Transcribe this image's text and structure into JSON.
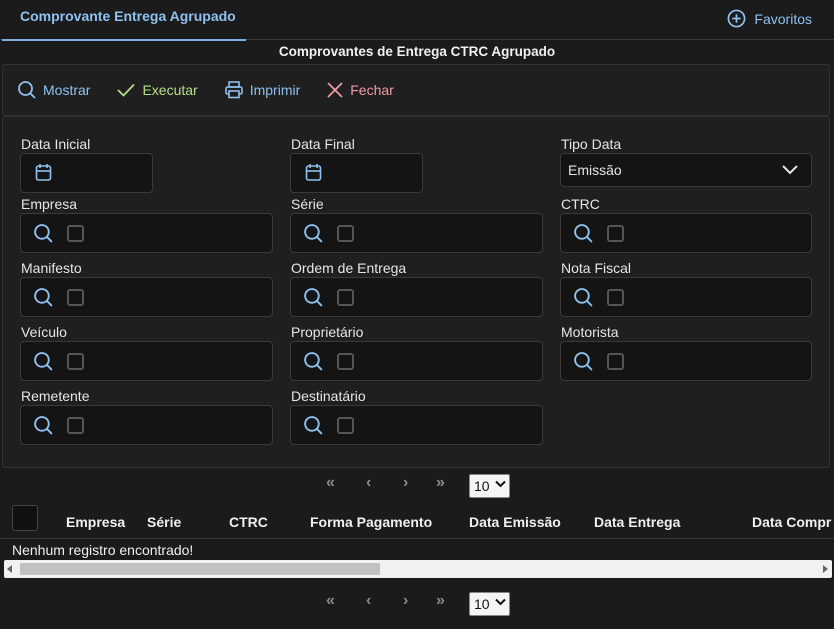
{
  "tabs": {
    "active_label": "Comprovante Entrega Agrupado"
  },
  "favoritos": {
    "label": "Favoritos"
  },
  "page": {
    "title": "Comprovantes de Entrega CTRC Agrupado"
  },
  "toolbar": {
    "mostrar": "Mostrar",
    "executar": "Executar",
    "imprimir": "Imprimir",
    "fechar": "Fechar"
  },
  "form": {
    "data_inicial": "Data Inicial",
    "data_final": "Data Final",
    "tipo_data": "Tipo Data",
    "tipo_data_value": "Emissão",
    "empresa": "Empresa",
    "serie": "Série",
    "ctrc": "CTRC",
    "manifesto": "Manifesto",
    "ordem_entrega": "Ordem de Entrega",
    "nota_fiscal": "Nota Fiscal",
    "veiculo": "Veículo",
    "proprietario": "Proprietário",
    "motorista": "Motorista",
    "remetente": "Remetente",
    "destinatario": "Destinatário"
  },
  "pager": {
    "first": "«",
    "prev": "‹",
    "next": "›",
    "last": "»",
    "rows_per_page": "10"
  },
  "grid": {
    "columns": [
      "Empresa",
      "Série",
      "CTRC",
      "Forma Pagamento",
      "Data Emissão",
      "Data Entrega",
      "Data Compr"
    ],
    "empty_message": "Nenhum registro encontrado!"
  },
  "colors": {
    "accent_blue": "#8ec1ef",
    "accent_green": "#b5e08a",
    "accent_red": "#f09aa8",
    "background": "#1b1b1b"
  },
  "icons": {
    "favoritos": "plus-circle-icon",
    "mostrar": "search-icon",
    "executar": "check-icon",
    "imprimir": "printer-icon",
    "fechar": "close-icon",
    "date": "calendar-icon",
    "select": "chevron-down-icon"
  }
}
